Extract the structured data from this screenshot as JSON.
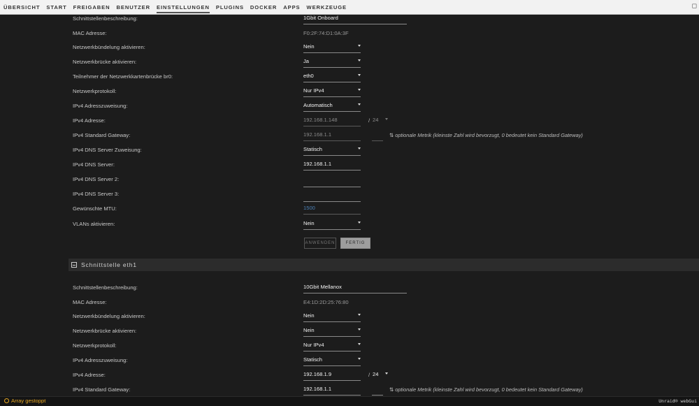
{
  "nav": {
    "items": [
      "ÜBERSICHT",
      "START",
      "FREIGABEN",
      "BENUTZER",
      "EINSTELLUNGEN",
      "PLUGINS",
      "DOCKER",
      "APPS",
      "WERKZEUGE"
    ],
    "active": "EINSTELLUNGEN"
  },
  "eth0": {
    "description_label": "Schnittstellenbeschreibung:",
    "description_value": "1Gbit Onboard",
    "mac_label": "MAC Adresse:",
    "mac_value": "F0:2F:74:D1:0A:3F",
    "bonding_label": "Netzwerkbündelung aktivieren:",
    "bonding_value": "Nein",
    "bridge_label": "Netzwerkbrücke aktivieren:",
    "bridge_value": "Ja",
    "bridge_members_label": "Teilnehmer der Netzwerkkartenbrücke br0:",
    "bridge_members_value": "eth0",
    "protocol_label": "Netzwerkprotokoll:",
    "protocol_value": "Nur IPv4",
    "ipv4_assign_label": "IPv4 Adresszuweisung:",
    "ipv4_assign_value": "Automatisch",
    "ipv4_address_label": "IPv4 Adresse:",
    "ipv4_address_value": "192.168.1.148",
    "ipv4_mask_value": "24",
    "gateway_label": "IPv4 Standard Gateway:",
    "gateway_value": "192.168.1.1",
    "gateway_note": "optionale Metrik (kleinste Zahl wird bevorzugt, 0 bedeutet kein Standard Gateway)",
    "dns_assign_label": "IPv4 DNS Server Zuweisung:",
    "dns_assign_value": "Statisch",
    "dns1_label": "IPv4 DNS Server:",
    "dns1_value": "192.168.1.1",
    "dns2_label": "IPv4 DNS Server 2:",
    "dns3_label": "IPv4 DNS Server 3:",
    "mtu_label": "Gewünschte MTU:",
    "mtu_value": "1500",
    "vlan_label": "VLANs aktivieren:",
    "vlan_value": "Nein",
    "apply_label": "ANWENDEN",
    "done_label": "FERTIG"
  },
  "eth1": {
    "section_title": "Schnittstelle eth1",
    "description_label": "Schnittstellenbeschreibung:",
    "description_value": "10Gbit Mellanox",
    "mac_label": "MAC Adresse:",
    "mac_value": "E4:1D:2D:25:76:80",
    "bonding_label": "Netzwerkbündelung aktivieren:",
    "bonding_value": "Nein",
    "bridge_label": "Netzwerkbrücke aktivieren:",
    "bridge_value": "Nein",
    "protocol_label": "Netzwerkprotokoll:",
    "protocol_value": "Nur IPv4",
    "ipv4_assign_label": "IPv4 Adresszuweisung:",
    "ipv4_assign_value": "Statisch",
    "ipv4_address_label": "IPv4 Adresse:",
    "ipv4_address_value": "192.168.1.9",
    "ipv4_mask_value": "24",
    "gateway_label": "IPv4 Standard Gateway:",
    "gateway_value": "192.168.1.1",
    "gateway_note": "optionale Metrik (kleinste Zahl wird bevorzugt, 0 bedeutet kein Standard Gateway)"
  },
  "footer": {
    "status": "Array gestoppt",
    "brand": "Unraid® webGui"
  },
  "colors": {
    "background": "#1c1c1c",
    "nav_background": "#f2f2f2",
    "status_warning": "#e6a623",
    "link": "#4a7fb5"
  }
}
